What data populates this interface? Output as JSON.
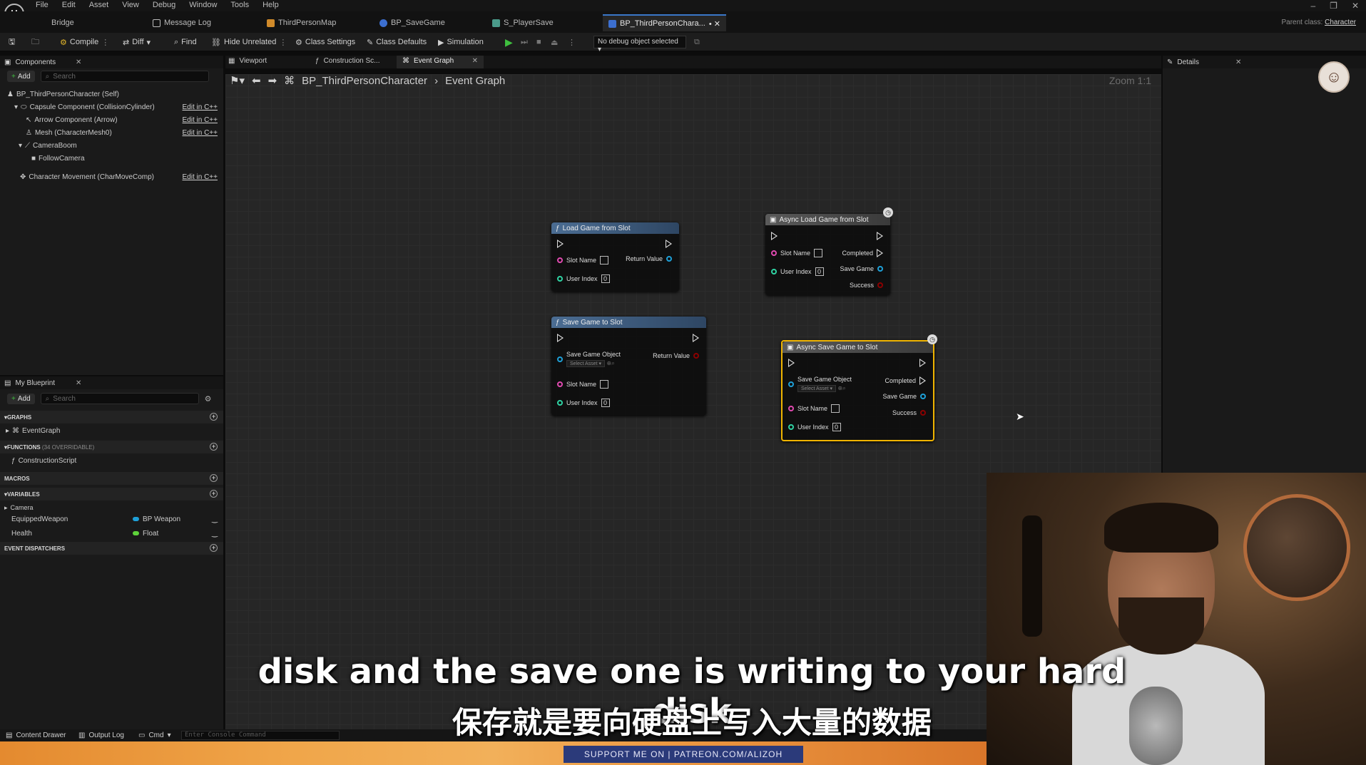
{
  "menu": {
    "items": [
      "File",
      "Edit",
      "Asset",
      "View",
      "Debug",
      "Window",
      "Tools",
      "Help"
    ]
  },
  "tabs": {
    "bridge": "Bridge",
    "message_log": "Message Log",
    "map": "ThirdPersonMap",
    "savegame": "BP_SaveGame",
    "playersave": "S_PlayerSave",
    "active": "BP_ThirdPersonChara...",
    "parent_label": "Parent class:",
    "parent_value": "Character"
  },
  "toolbar": {
    "compile": "Compile",
    "diff": "Diff",
    "find": "Find",
    "hide_unrelated": "Hide Unrelated",
    "class_settings": "Class Settings",
    "class_defaults": "Class Defaults",
    "simulation": "Simulation",
    "debug_object": "No debug object selected"
  },
  "components": {
    "title": "Components",
    "add": "Add",
    "search_placeholder": "Search",
    "edit_cpp": "Edit in C++",
    "items": [
      "BP_ThirdPersonCharacter (Self)",
      "Capsule Component (CollisionCylinder)",
      "Arrow Component (Arrow)",
      "Mesh (CharacterMesh0)",
      "CameraBoom",
      "FollowCamera",
      "Character Movement (CharMoveComp)"
    ]
  },
  "editor_tabs": {
    "viewport": "Viewport",
    "construction": "Construction Sc...",
    "event_graph": "Event Graph"
  },
  "breadcrumb": {
    "root": "BP_ThirdPersonCharacter",
    "current": "Event Graph",
    "zoom": "Zoom 1:1"
  },
  "details": {
    "title": "Details"
  },
  "my_blueprint": {
    "title": "My Blueprint",
    "add": "Add",
    "search_placeholder": "Search",
    "graphs": "GRAPHS",
    "event_graph": "EventGraph",
    "functions": "FUNCTIONS",
    "functions_note": "(34 OVERRIDABLE)",
    "construction_script": "ConstructionScript",
    "macros": "MACROS",
    "variables": "VARIABLES",
    "camera": "Camera",
    "var1_name": "EquippedWeapon",
    "var1_type": "BP Weapon",
    "var2_name": "Health",
    "var2_type": "Float",
    "dispatchers": "EVENT DISPATCHERS"
  },
  "nodes": {
    "load": {
      "title": "Load Game from Slot",
      "slot": "Slot Name",
      "user": "User Index",
      "user_val": "0",
      "ret": "Return Value"
    },
    "async_load": {
      "title": "Async Load Game from Slot",
      "slot": "Slot Name",
      "user": "User Index",
      "user_val": "0",
      "completed": "Completed",
      "save_game": "Save Game",
      "success": "Success"
    },
    "save": {
      "title": "Save Game to Slot",
      "obj": "Save Game Object",
      "select": "Select Asset",
      "slot": "Slot Name",
      "user": "User Index",
      "user_val": "0",
      "ret": "Return Value"
    },
    "async_save": {
      "title": "Async Save Game to Slot",
      "obj": "Save Game Object",
      "select": "Select Asset",
      "slot": "Slot Name",
      "user": "User Index",
      "user_val": "0",
      "completed": "Completed",
      "save_game": "Save Game",
      "success": "Success"
    }
  },
  "status": {
    "content_drawer": "Content Drawer",
    "output_log": "Output Log",
    "cmd": "Cmd",
    "console_placeholder": "Enter Console Command"
  },
  "promo": {
    "text": "SUPPORT ME ON | PATREON.COM/ALIZOH"
  },
  "subtitles": {
    "en": "disk and the save one is writing to your hard disk",
    "zh": "保存就是要向硬盘上写入大量的数据"
  },
  "colors": {
    "accent": "#3a77c8",
    "selected_node": "#f0b400",
    "patreon": "#2b3a7a"
  }
}
